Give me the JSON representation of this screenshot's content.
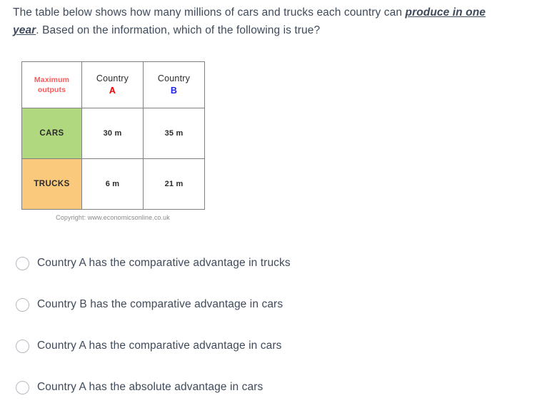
{
  "question": {
    "text_before": "The table below shows how many millions of cars and trucks each country can ",
    "emphasis": "produce in one year",
    "text_after": ". Based on the information, which of the following is true?"
  },
  "figure": {
    "table": {
      "header": {
        "corner_label": "Maximum outputs",
        "corner_label_line1": "Maximum",
        "corner_label_line2": "outputs",
        "columns": [
          {
            "name": "Country",
            "letter": "A",
            "letter_color": "#ee0000"
          },
          {
            "name": "Country",
            "letter": "B",
            "letter_color": "#2222ee"
          }
        ]
      },
      "rows": [
        {
          "label": "CARS",
          "label_color": "#b0d97f",
          "country_a": "30 m",
          "country_b": "35 m"
        },
        {
          "label": "TRUCKS",
          "label_color": "#fac97c",
          "country_a": "6 m",
          "country_b": "21 m"
        }
      ]
    },
    "copyright": "Copyright: www.economicsonline.co.uk"
  },
  "options": [
    {
      "label": "Country A has the comparative advantage in trucks",
      "selected": false
    },
    {
      "label": "Country B has the comparative advantage in cars",
      "selected": false
    },
    {
      "label": "Country A has the comparative advantage in cars",
      "selected": false
    },
    {
      "label": "Country A has the absolute advantage in cars",
      "selected": false
    }
  ],
  "colors": {
    "text": "#3f4a5a",
    "accent_red": "#fa5a5a",
    "cars_green": "#b0d97f",
    "trucks_orange": "#fac97c",
    "table_border": "#808080"
  }
}
